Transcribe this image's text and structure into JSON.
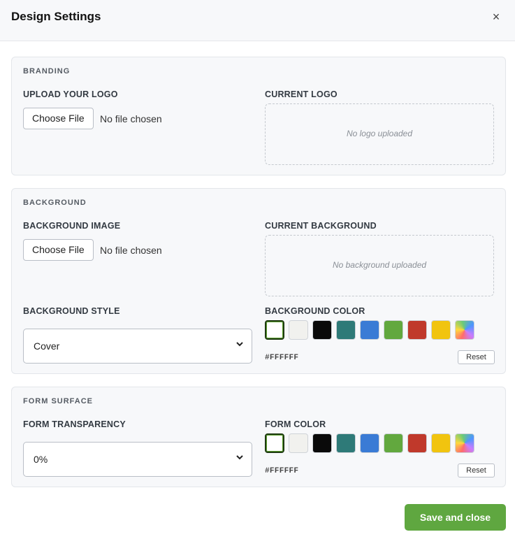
{
  "dialog": {
    "title": "Design Settings",
    "close_label": "×"
  },
  "branding": {
    "section_title": "BRANDING",
    "upload_label": "UPLOAD YOUR LOGO",
    "choose_file": "Choose File",
    "file_status": "No file chosen",
    "current_label": "CURRENT LOGO",
    "current_placeholder": "No logo uploaded"
  },
  "background": {
    "section_title": "BACKGROUND",
    "image_label": "BACKGROUND IMAGE",
    "choose_file": "Choose File",
    "file_status": "No file chosen",
    "current_label": "CURRENT BACKGROUND",
    "current_placeholder": "No background uploaded",
    "style_label": "BACKGROUND STYLE",
    "style_value": "Cover",
    "color_label": "BACKGROUND COLOR",
    "hex": "#FFFFFF",
    "reset": "Reset"
  },
  "form_surface": {
    "section_title": "FORM SURFACE",
    "transparency_label": "FORM TRANSPARENCY",
    "transparency_value": "0%",
    "color_label": "FORM COLOR",
    "hex": "#FFFFFF",
    "reset": "Reset"
  },
  "swatch_colors": [
    "#FFFFFF",
    "#F1F1EE",
    "#0A0A0A",
    "#2E7A78",
    "#3A7BD5",
    "#62A83E",
    "#C0392B",
    "#F1C40F",
    "rainbow"
  ],
  "selected_swatch": "#FFFFFF",
  "footer": {
    "save_label": "Save and close"
  },
  "colors": {
    "accent": "#5FA740",
    "selected_border": "#1F3B12"
  }
}
